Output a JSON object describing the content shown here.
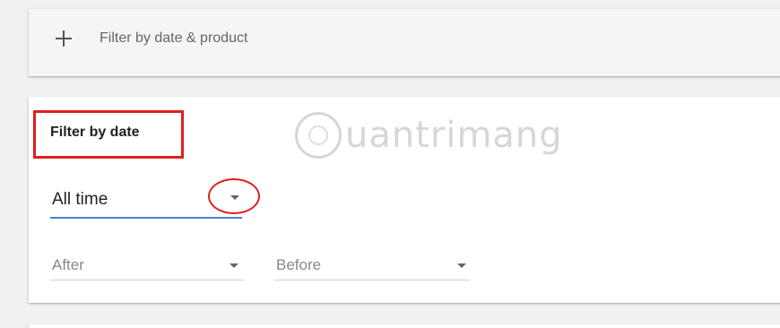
{
  "expander": {
    "label": "Filter by date & product",
    "icon": "plus-icon"
  },
  "filter_section": {
    "title": "Filter by date"
  },
  "watermark": {
    "text": "uantrimang",
    "icon": "lightbulb-icon"
  },
  "date_range_select": {
    "value": "All time",
    "icon": "dropdown-arrow-icon"
  },
  "after_select": {
    "placeholder": "After"
  },
  "before_select": {
    "placeholder": "Before"
  },
  "colors": {
    "annotation": "#e01f1f",
    "focus_underline": "#4a7fd6"
  }
}
